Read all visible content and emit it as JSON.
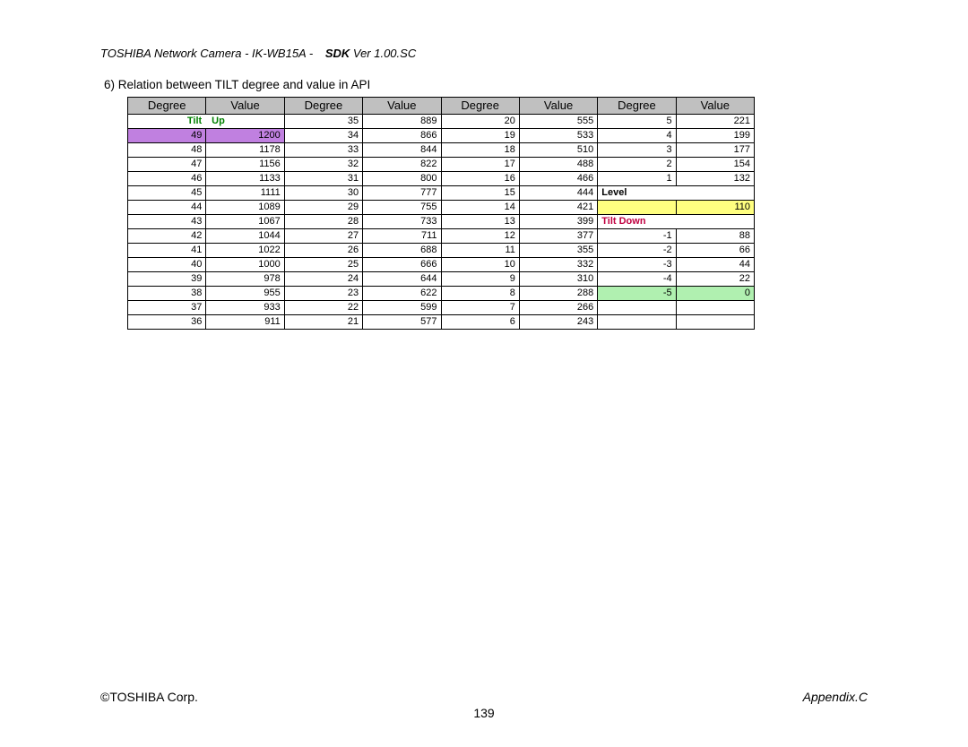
{
  "header": {
    "product": "TOSHIBA Network Camera - IK-WB15A -",
    "sdk_label": "SDK",
    "sdk_ver": " Ver 1.00.SC"
  },
  "section_title": "6)  Relation between TILT degree and value in API",
  "columns": [
    "Degree",
    "Value",
    "Degree",
    "Value",
    "Degree",
    "Value",
    "Degree",
    "Value"
  ],
  "labels": {
    "tilt_up": "Tilt　Up",
    "level": "Level",
    "tilt_down": "Tilt Down"
  },
  "chart_data": {
    "type": "table",
    "title": "Relation between TILT degree and value in API",
    "xlabel": "Degree",
    "ylabel": "Value",
    "columns_layout": 4,
    "rows": [
      {
        "c1_deg": "",
        "c1_val": "",
        "c2_deg": 35,
        "c2_val": 889,
        "c3_deg": 20,
        "c3_val": 555,
        "c4_deg": 5,
        "c4_val": 221,
        "c1_label": "tilt_up"
      },
      {
        "c1_deg": 49,
        "c1_val": 1200,
        "c2_deg": 34,
        "c2_val": 866,
        "c3_deg": 19,
        "c3_val": 533,
        "c4_deg": 4,
        "c4_val": 199,
        "c1_hl": "purple"
      },
      {
        "c1_deg": 48,
        "c1_val": 1178,
        "c2_deg": 33,
        "c2_val": 844,
        "c3_deg": 18,
        "c3_val": 510,
        "c4_deg": 3,
        "c4_val": 177
      },
      {
        "c1_deg": 47,
        "c1_val": 1156,
        "c2_deg": 32,
        "c2_val": 822,
        "c3_deg": 17,
        "c3_val": 488,
        "c4_deg": 2,
        "c4_val": 154
      },
      {
        "c1_deg": 46,
        "c1_val": 1133,
        "c2_deg": 31,
        "c2_val": 800,
        "c3_deg": 16,
        "c3_val": 466,
        "c4_deg": 1,
        "c4_val": 132
      },
      {
        "c1_deg": 45,
        "c1_val": 1111,
        "c2_deg": 30,
        "c2_val": 777,
        "c3_deg": 15,
        "c3_val": 444,
        "c4_label": "level"
      },
      {
        "c1_deg": 44,
        "c1_val": 1089,
        "c2_deg": 29,
        "c2_val": 755,
        "c3_deg": 14,
        "c3_val": 421,
        "c4_deg": "",
        "c4_val": 110,
        "c4_hl": "yellow"
      },
      {
        "c1_deg": 43,
        "c1_val": 1067,
        "c2_deg": 28,
        "c2_val": 733,
        "c3_deg": 13,
        "c3_val": 399,
        "c4_label": "tilt_down"
      },
      {
        "c1_deg": 42,
        "c1_val": 1044,
        "c2_deg": 27,
        "c2_val": 711,
        "c3_deg": 12,
        "c3_val": 377,
        "c4_deg": -1,
        "c4_val": 88
      },
      {
        "c1_deg": 41,
        "c1_val": 1022,
        "c2_deg": 26,
        "c2_val": 688,
        "c3_deg": 11,
        "c3_val": 355,
        "c4_deg": -2,
        "c4_val": 66
      },
      {
        "c1_deg": 40,
        "c1_val": 1000,
        "c2_deg": 25,
        "c2_val": 666,
        "c3_deg": 10,
        "c3_val": 332,
        "c4_deg": -3,
        "c4_val": 44
      },
      {
        "c1_deg": 39,
        "c1_val": 978,
        "c2_deg": 24,
        "c2_val": 644,
        "c3_deg": 9,
        "c3_val": 310,
        "c4_deg": -4,
        "c4_val": 22
      },
      {
        "c1_deg": 38,
        "c1_val": 955,
        "c2_deg": 23,
        "c2_val": 622,
        "c3_deg": 8,
        "c3_val": 288,
        "c4_deg": -5,
        "c4_val": 0,
        "c4_hl": "green"
      },
      {
        "c1_deg": 37,
        "c1_val": 933,
        "c2_deg": 22,
        "c2_val": 599,
        "c3_deg": 7,
        "c3_val": 266,
        "c4_deg": "",
        "c4_val": ""
      },
      {
        "c1_deg": 36,
        "c1_val": 911,
        "c2_deg": 21,
        "c2_val": 577,
        "c3_deg": 6,
        "c3_val": 243,
        "c4_deg": "",
        "c4_val": ""
      }
    ]
  },
  "footer": {
    "left": "©TOSHIBA Corp.",
    "right": "Appendix.C",
    "page_no": "139"
  }
}
